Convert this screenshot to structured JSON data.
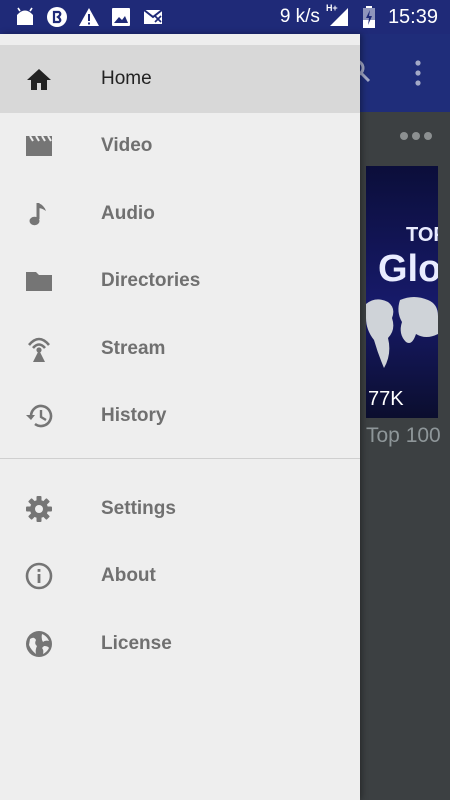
{
  "status_bar": {
    "speed": "9 k/s",
    "network": "H+",
    "time": "15:39",
    "left_icons": [
      "android-icon",
      "sync-circle-icon",
      "warning-icon",
      "image-icon",
      "mail-off-icon"
    ]
  },
  "drawer": {
    "primary_items": [
      {
        "label": "Home",
        "icon": "home-icon",
        "active": true
      },
      {
        "label": "Video",
        "icon": "video-icon"
      },
      {
        "label": "Audio",
        "icon": "music-note-icon"
      },
      {
        "label": "Directories",
        "icon": "folder-icon"
      },
      {
        "label": "Stream",
        "icon": "stream-antenna-icon"
      },
      {
        "label": "History",
        "icon": "history-icon"
      }
    ],
    "secondary_items": [
      {
        "label": "Settings",
        "icon": "gear-icon"
      },
      {
        "label": "About",
        "icon": "info-icon"
      },
      {
        "label": "License",
        "icon": "globe-icon"
      }
    ]
  },
  "background": {
    "thumbnail_text_1": "TOP",
    "thumbnail_text_2": "Glo",
    "thumbnail_views": "77K",
    "item_title": "Top 100"
  },
  "colors": {
    "status_bar": "#1f2a78",
    "toolbar": "#1f2d7a",
    "drawer_bg": "#eeeeee",
    "active_item_bg": "#d8d8d8",
    "label_text": "#707070",
    "icon_color": "#757575"
  }
}
